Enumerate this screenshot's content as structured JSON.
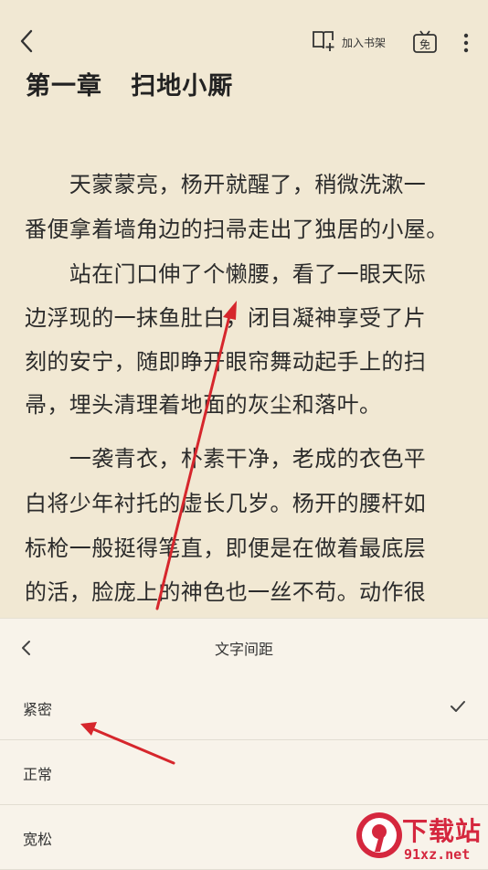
{
  "header": {
    "add_to_shelf_label": "加入书架",
    "free_badge": "免"
  },
  "reader": {
    "chapter_title": "第一章   扫地小厮",
    "lines": [
      "　　天蒙蒙亮，杨开就醒了，稍微洗漱一",
      "番便拿着墙角边的扫帚走出了独居的小屋。",
      "　　站在门口伸了个懒腰，看了一眼天际",
      "边浮现的一抹鱼肚白，闭目凝神享受了片",
      "刻的安宁，随即睁开眼帘舞动起手上的扫",
      "帚，埋头清理着地面的灰尘和落叶。",
      "　　一袭青衣，朴素干净，老成的衣色平",
      "白将少年衬托的虚长几岁。杨开的腰杆如",
      "标枪一般挺得笔直，即便是在做着最底层",
      "的活，脸庞上的神色也一丝不苟。动作很"
    ]
  },
  "panel": {
    "title": "文字间距",
    "options": [
      {
        "label": "紧密",
        "selected": true
      },
      {
        "label": "正常",
        "selected": false
      },
      {
        "label": "宽松",
        "selected": false
      }
    ]
  },
  "watermark": {
    "brand": "下载站",
    "domain": "91xz.net"
  },
  "colors": {
    "page_bg": "#f1e8d3",
    "panel_bg": "#f8f4ec",
    "annotation_arrow": "#d6262c",
    "watermark": "#d5273e"
  }
}
